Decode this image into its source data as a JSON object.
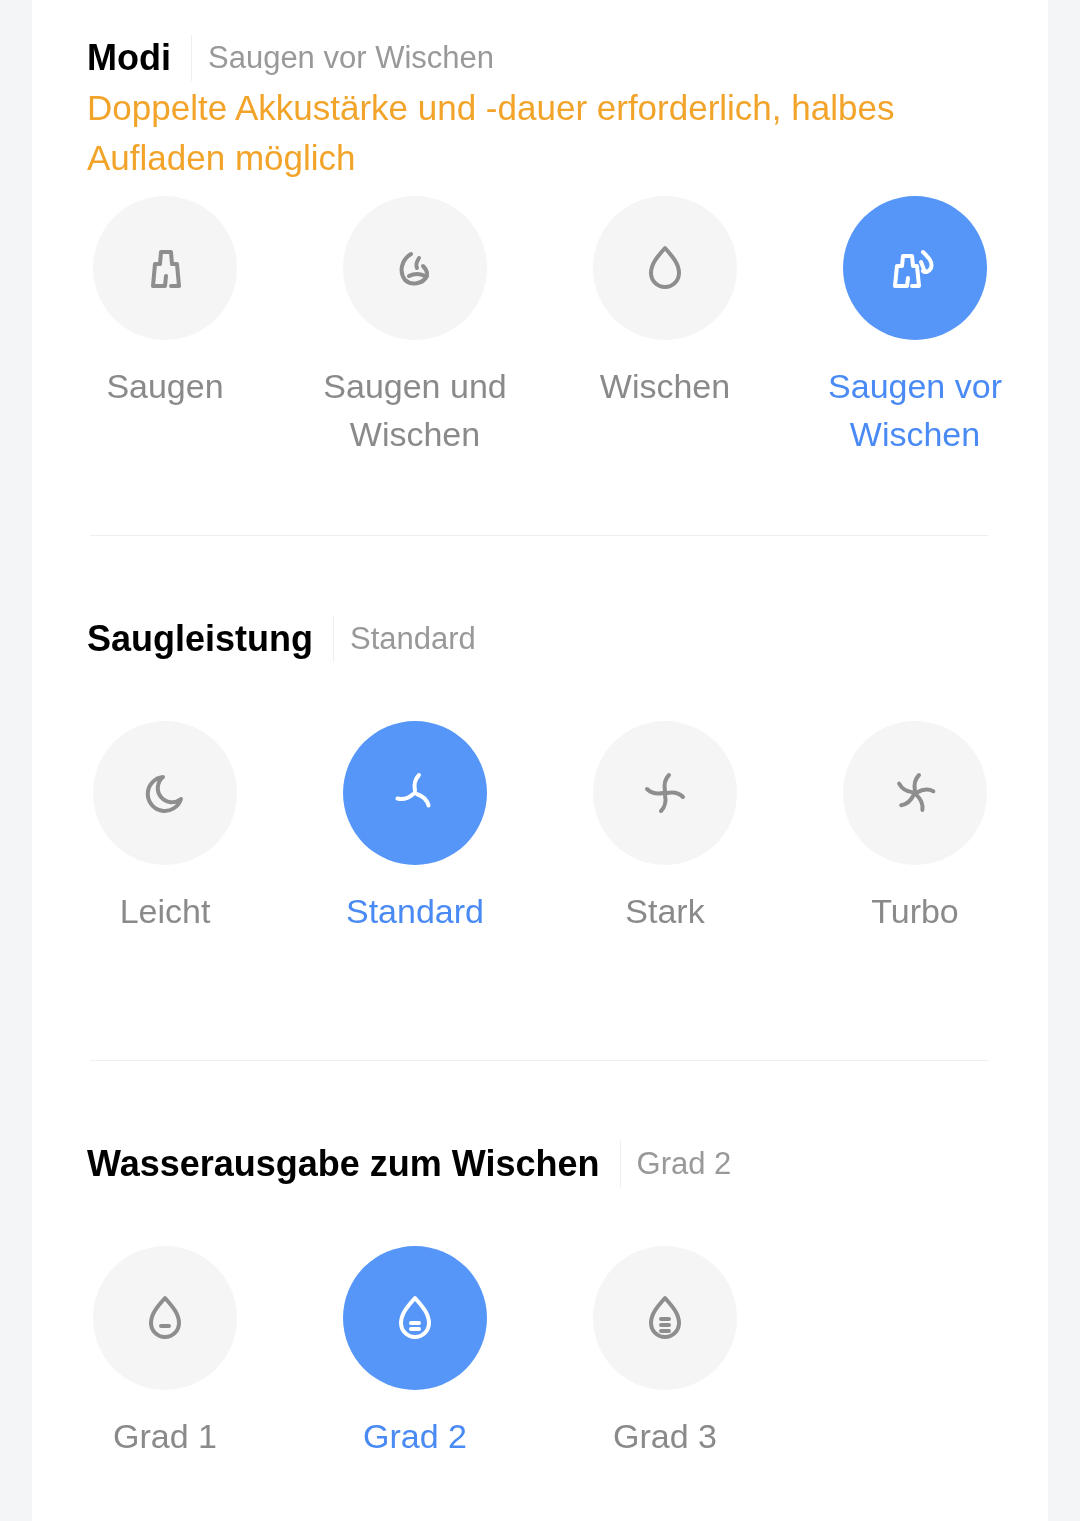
{
  "sections": [
    {
      "title": "Modi",
      "value": "Saugen vor Wischen",
      "note": "Doppelte Akkustärke und -dauer erforderlich, halbes Aufladen möglich",
      "options": [
        {
          "label": "Saugen",
          "kind": "vacuum",
          "selected": false
        },
        {
          "label": "Saugen und Wischen",
          "kind": "vacuum-mop",
          "selected": false
        },
        {
          "label": "Wischen",
          "kind": "drop",
          "selected": false
        },
        {
          "label": "Saugen vor Wischen",
          "kind": "vacuum-then-mop",
          "selected": true
        }
      ]
    },
    {
      "title": "Saugleistung",
      "value": "Standard",
      "options": [
        {
          "label": "Leicht",
          "kind": "moon",
          "selected": false
        },
        {
          "label": "Standard",
          "kind": "fan3",
          "selected": true
        },
        {
          "label": "Stark",
          "kind": "fan4",
          "selected": false
        },
        {
          "label": "Turbo",
          "kind": "fan5",
          "selected": false
        }
      ]
    },
    {
      "title": "Wasserausgabe zum Wischen",
      "value": "Grad 2",
      "options": [
        {
          "label": "Grad 1",
          "kind": "water1",
          "selected": false
        },
        {
          "label": "Grad 2",
          "kind": "water2",
          "selected": true
        },
        {
          "label": "Grad 3",
          "kind": "water3",
          "selected": false
        }
      ]
    }
  ]
}
